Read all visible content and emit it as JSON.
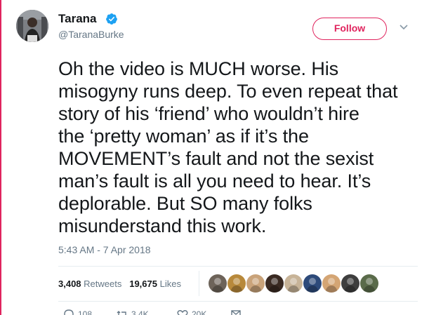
{
  "tweet": {
    "name": "Tarana",
    "handle": "@TaranaBurke",
    "follow_label": "Follow",
    "text_lines": [
      "Oh the video is MUCH worse. His",
      "misogyny runs deep. To even repeat that",
      "story of his ‘friend’ who wouldn’t hire",
      "the ‘pretty woman’ as if it’s the",
      "MOVEMENT’s fault and not the sexist",
      "man’s fault is all you need to hear. It’s",
      "deplorable. But SO many folks",
      "misunderstand this work."
    ],
    "timestamp": "5:43 AM - 7 Apr 2018",
    "retweets_count": "3,408",
    "retweets_label": "Retweets",
    "likes_count": "19,675",
    "likes_label": "Likes",
    "actions": {
      "reply_count": "108",
      "retweet_count": "3.4K",
      "like_count": "20K",
      "message_count": ""
    }
  },
  "colors": {
    "accent": "#e0245e",
    "verified": "#1da1f2",
    "secondary_text": "#657786"
  },
  "icons": {
    "verified": "verified-check-icon",
    "caret": "chevron-down-icon",
    "reply": "reply-icon",
    "retweet": "retweet-icon",
    "like": "heart-icon",
    "message": "envelope-icon"
  },
  "likers": [
    {
      "color": "#6d6359"
    },
    {
      "color": "#b8893b"
    },
    {
      "color": "#c9a37a"
    },
    {
      "color": "#3a2a22"
    },
    {
      "color": "#c8b498"
    },
    {
      "color": "#2d4a7a"
    },
    {
      "color": "#d4a574"
    },
    {
      "color": "#3e3e3e"
    },
    {
      "color": "#5a6b4a"
    }
  ]
}
